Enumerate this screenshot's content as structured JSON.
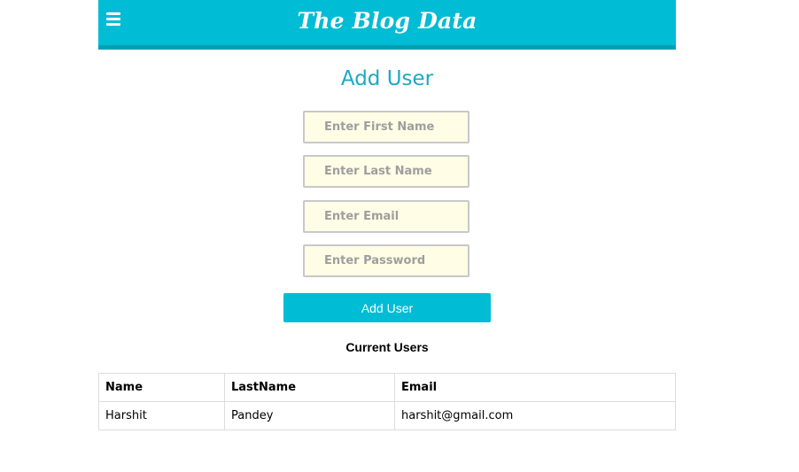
{
  "header": {
    "brand": "The Blog Data",
    "menu_icon": "hamburger-menu-icon"
  },
  "form": {
    "title": "Add User",
    "first_name_placeholder": "Enter First Name",
    "last_name_placeholder": "Enter Last Name",
    "email_placeholder": "Enter Email",
    "password_placeholder": "Enter Password",
    "submit_label": "Add User"
  },
  "users": {
    "title": "Current Users",
    "columns": [
      "Name",
      "LastName",
      "Email"
    ],
    "rows": [
      [
        "Harshit",
        "Pandey",
        "harshit@gmail.com"
      ]
    ]
  },
  "colors": {
    "accent": "#00bcd4",
    "accent_dark": "#00a0b4",
    "input_bg": "#fffde5"
  }
}
